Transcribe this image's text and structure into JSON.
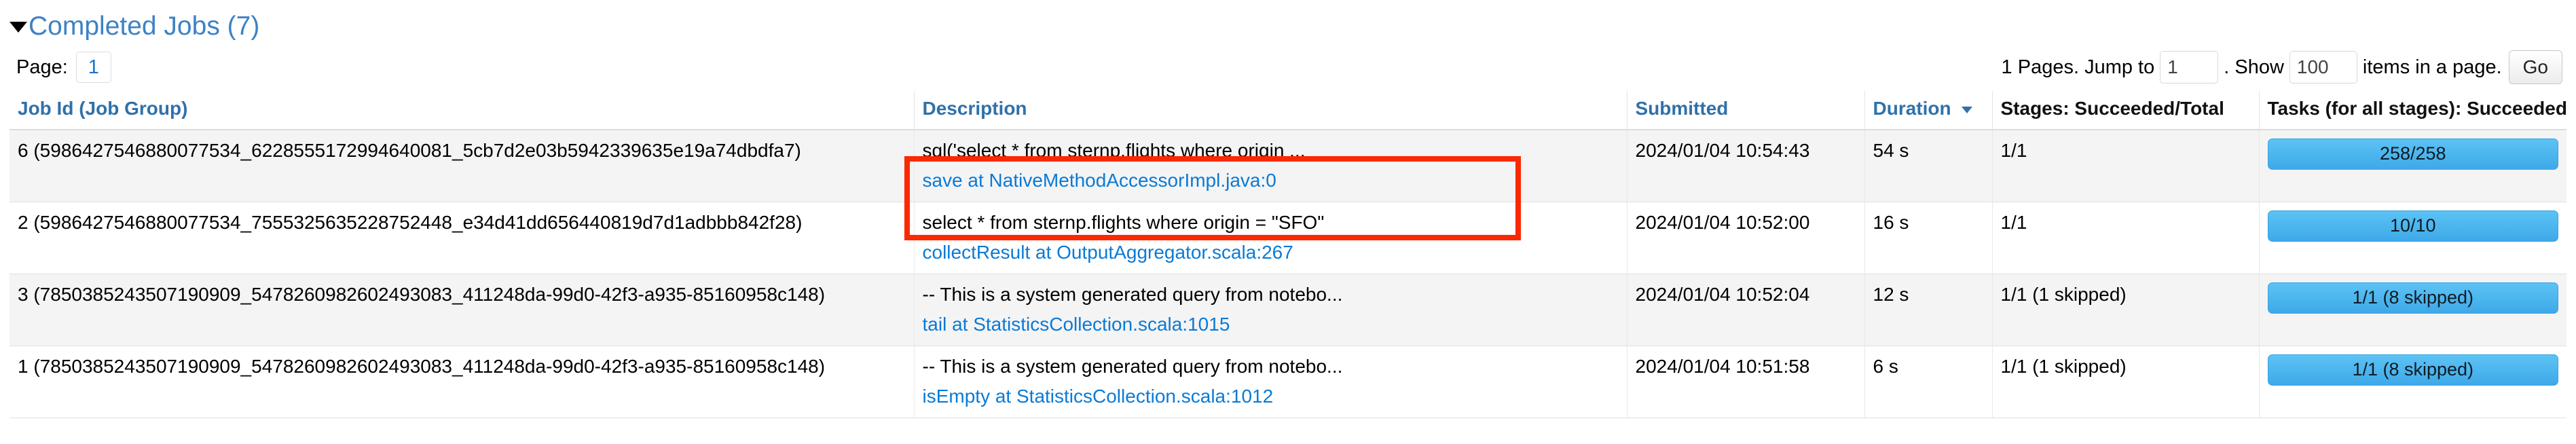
{
  "section": {
    "title": "Completed Jobs (7)",
    "caret_icon": "caret-down-icon",
    "expanded": true
  },
  "pager": {
    "page_label": "Page:",
    "current_page": "1",
    "pages_prefix": "1 Pages. Jump to",
    "jump_value": "1",
    "show_label": ". Show",
    "show_value": "100",
    "items_label": "items in a page.",
    "go_label": "Go"
  },
  "table": {
    "columns": [
      {
        "label": "Job Id (Job Group)",
        "sortable": true,
        "sorted": false
      },
      {
        "label": "Description",
        "sortable": true,
        "sorted": false
      },
      {
        "label": "Submitted",
        "sortable": true,
        "sorted": false
      },
      {
        "label": "Duration",
        "sortable": true,
        "sorted": true,
        "sort_dir": "desc"
      },
      {
        "label": "Stages: Succeeded/Total",
        "sortable": false,
        "sorted": false
      },
      {
        "label": "Tasks (for all stages): Succeeded/Total",
        "sortable": false,
        "sorted": false
      }
    ],
    "rows": [
      {
        "job_id": "6 (5986427546880077534_6228555172994640081_5cb7d2e03b5942339635e19a74dbdfa7)",
        "description": "sql('select * from sternp.flights where origin ...",
        "description_link": "save at NativeMethodAccessorImpl.java:0",
        "submitted": "2024/01/04 10:54:43",
        "duration": "54 s",
        "stages": "1/1",
        "tasks": "258/258",
        "highlighted": true
      },
      {
        "job_id": "2 (5986427546880077534_7555325635228752448_e34d41dd656440819d7d1adbbb842f28)",
        "description": "select * from sternp.flights where origin = \"SFO\"",
        "description_link": "collectResult at OutputAggregator.scala:267",
        "submitted": "2024/01/04 10:52:00",
        "duration": "16 s",
        "stages": "1/1",
        "tasks": "10/10",
        "highlighted": false
      },
      {
        "job_id": "3 (7850385243507190909_5478260982602493083_411248da-99d0-42f3-a935-85160958c148)",
        "description": "-- This is a system generated query from notebo...",
        "description_link": "tail at StatisticsCollection.scala:1015",
        "submitted": "2024/01/04 10:52:04",
        "duration": "12 s",
        "stages": "1/1 (1 skipped)",
        "tasks": "1/1 (8 skipped)",
        "highlighted": false
      },
      {
        "job_id": "1 (7850385243507190909_5478260982602493083_411248da-99d0-42f3-a935-85160958c148)",
        "description": "-- This is a system generated query from notebo...",
        "description_link": "isEmpty at StatisticsCollection.scala:1012",
        "submitted": "2024/01/04 10:51:58",
        "duration": "6 s",
        "stages": "1/1 (1 skipped)",
        "tasks": "1/1 (8 skipped)",
        "highlighted": false
      }
    ]
  },
  "colors": {
    "link": "#0a7ad6",
    "header_link": "#3071a9",
    "title": "#3d82c4",
    "progress_bar": "#4fb8ef",
    "annotation": "#fb2800"
  }
}
